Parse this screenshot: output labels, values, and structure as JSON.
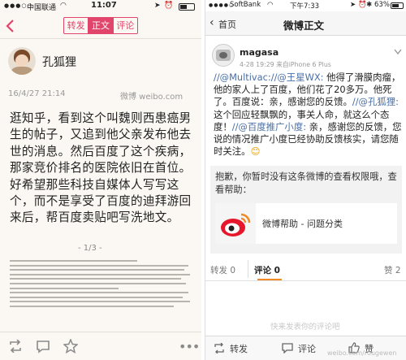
{
  "left": {
    "status": {
      "carrier": "中国联通",
      "time": "11:07"
    },
    "nav": {
      "segments": [
        "转发",
        "正文",
        "评论"
      ],
      "active": 1
    },
    "author": {
      "name": "孔狐狸",
      "date": "16/4/27 21:14",
      "source": "微博 weibo.com"
    },
    "article": "逛知乎，看到这个叫魏则西患癌男生的帖子，又追到他父亲发布他去世的消息。然后百度了这个疾病，那家竞价排名的医院依旧在首位。好希望那些科技自媒体人写写这个，而不是享受了百度的迪拜游回来后，帮百度卖贴吧写洗地文。",
    "page_indicator": "- 1/3 -"
  },
  "right": {
    "status": {
      "carrier": "SoftBank",
      "time": "下午7:33",
      "battery": "63%"
    },
    "nav": {
      "back": "首页",
      "title": "微博正文"
    },
    "author": {
      "name": "magasa",
      "meta": "4-28 19:29 来自iPhone 6 Plus"
    },
    "post": {
      "p1": "//@Multivac:",
      "p2": "//@王星WX:",
      "p3": " 他得了滑膜肉瘤，他的家人上了百度，他们花了20多万。他死了。百度说：亲，感谢您的反馈。",
      "p4": "//@孔狐狸:",
      "p5": " 这个回应轻飘飘的，事关人命，就这么个态度！",
      "p6": "//@百度推广小度:",
      "p7": " 亲，感谢您的反馈，您说的情况推广小度已经协助反馈核实，请您随时关注。",
      "emoji": "😊"
    },
    "notice": "抱歉，你暂时没有这条微博的查看权限哦，查看帮助：",
    "card_label": "微博帮助 - 问题分类",
    "tabs": {
      "repost": "转发 0",
      "comment": "评论 0",
      "like": "赞 2"
    },
    "bottom": {
      "repost": "转发",
      "comment": "评论",
      "like": "赞"
    },
    "footer_hint": "快来发表你的评论吧",
    "watermark": "weibo.com/rougewen"
  },
  "colors": {
    "accent_pink": "#e2456b",
    "weibo_orange": "#f08a24",
    "link_blue": "#4a6fa5"
  }
}
